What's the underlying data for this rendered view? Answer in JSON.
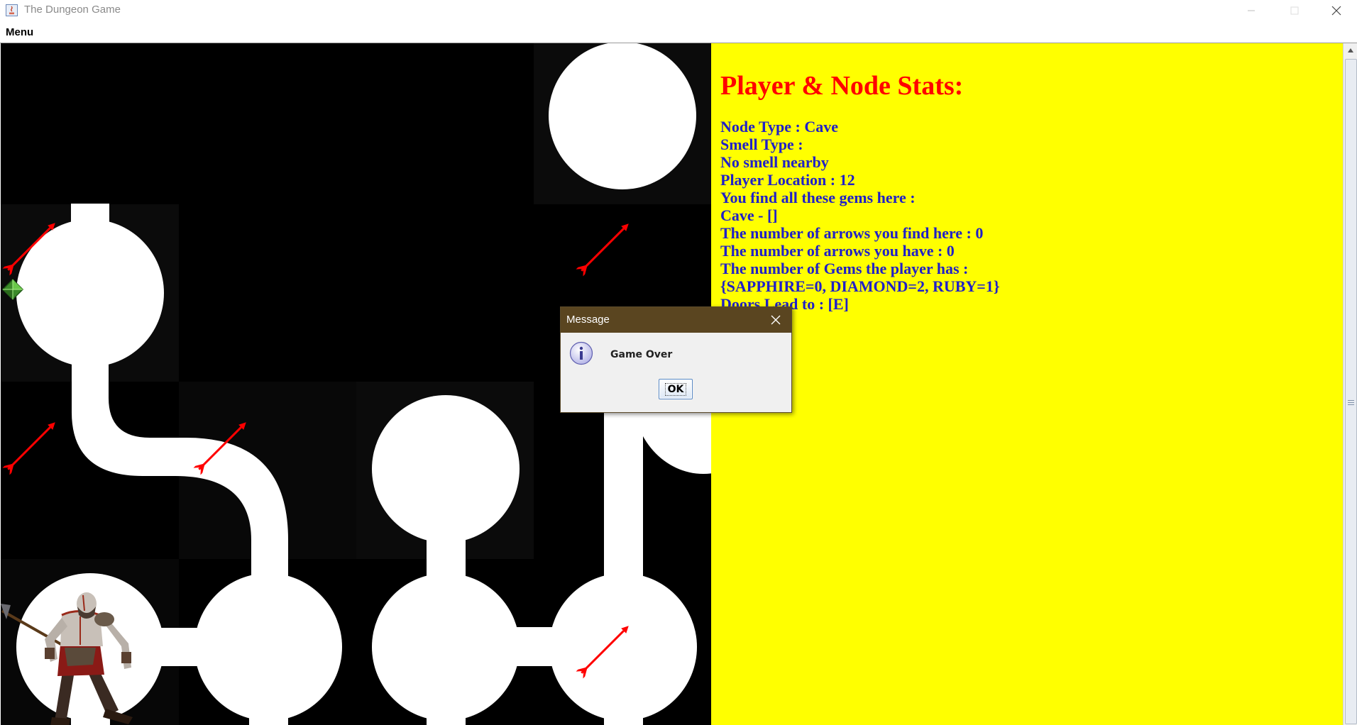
{
  "window": {
    "title": "The Dungeon Game",
    "menu_label": "Menu"
  },
  "stats_panel": {
    "title": "Player & Node Stats:",
    "lines": [
      "Node Type : Cave",
      "Smell Type :",
      "No smell nearby",
      "Player Location : 12",
      "You find all these gems here :",
      "Cave - []",
      "The number of arrows you find here : 0",
      "The number of arrows you have : 0",
      "The number of Gems the player has :",
      "{SAPPHIRE=0, DIAMOND=2, RUBY=1}",
      "Doors Lead to : [E]"
    ],
    "colors": {
      "background": "#ffff00",
      "title": "#ff0000",
      "text": "#2020c8"
    }
  },
  "dialog": {
    "title": "Message",
    "message": "Game Over",
    "ok_label": "OK",
    "icon": "info-icon"
  },
  "board": {
    "icons": [
      "arrow-icon",
      "green-gem-icon",
      "player-character"
    ],
    "colors": {
      "background": "#000000",
      "path": "#ffffff",
      "arrow": "#ff0000"
    }
  }
}
